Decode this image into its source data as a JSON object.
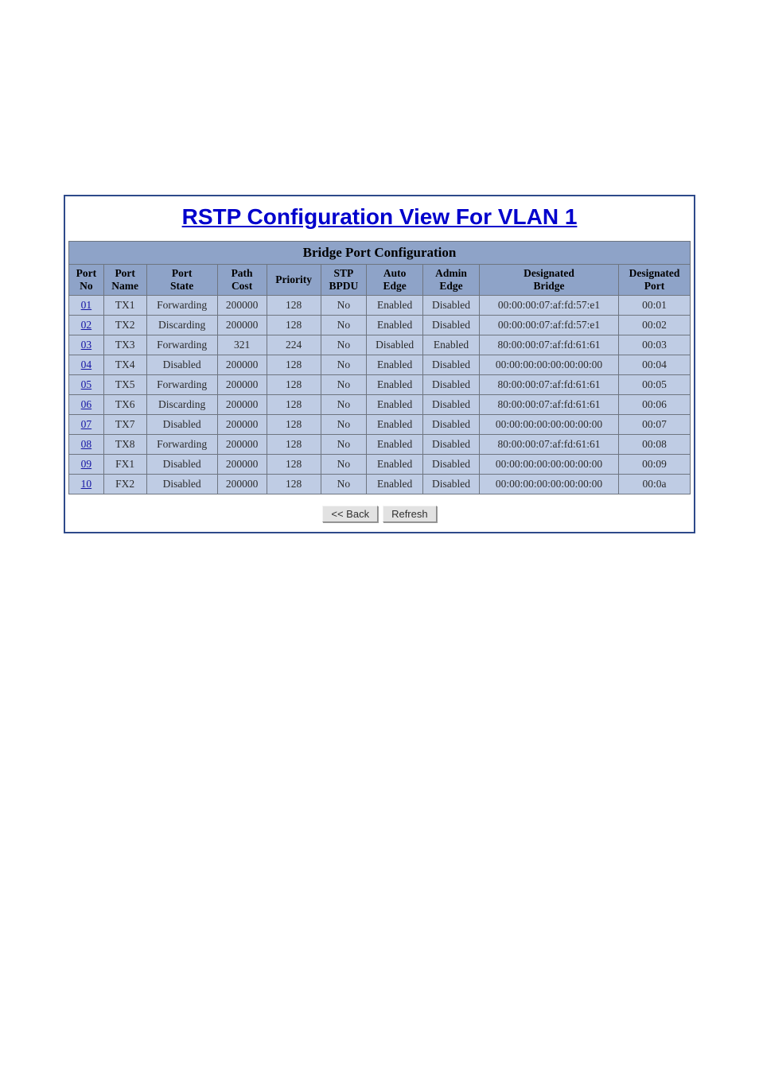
{
  "title": "RSTP Configuration View For VLAN 1",
  "table_caption": "Bridge Port Configuration",
  "headers": {
    "port_no": "Port\nNo",
    "port_name": "Port\nName",
    "port_state": "Port\nState",
    "path_cost": "Path\nCost",
    "priority": "Priority",
    "stp_bpdu": "STP\nBPDU",
    "auto_edge": "Auto\nEdge",
    "admin_edge": "Admin\nEdge",
    "designated_bridge": "Designated\nBridge",
    "designated_port": "Designated\nPort"
  },
  "rows": [
    {
      "port_no": "01",
      "port_name": "TX1",
      "port_state": "Forwarding",
      "path_cost": "200000",
      "priority": "128",
      "stp_bpdu": "No",
      "auto_edge": "Enabled",
      "admin_edge": "Disabled",
      "designated_bridge": "00:00:00:07:af:fd:57:e1",
      "designated_port": "00:01"
    },
    {
      "port_no": "02",
      "port_name": "TX2",
      "port_state": "Discarding",
      "path_cost": "200000",
      "priority": "128",
      "stp_bpdu": "No",
      "auto_edge": "Enabled",
      "admin_edge": "Disabled",
      "designated_bridge": "00:00:00:07:af:fd:57:e1",
      "designated_port": "00:02"
    },
    {
      "port_no": "03",
      "port_name": "TX3",
      "port_state": "Forwarding",
      "path_cost": "321",
      "priority": "224",
      "stp_bpdu": "No",
      "auto_edge": "Disabled",
      "admin_edge": "Enabled",
      "designated_bridge": "80:00:00:07:af:fd:61:61",
      "designated_port": "00:03"
    },
    {
      "port_no": "04",
      "port_name": "TX4",
      "port_state": "Disabled",
      "path_cost": "200000",
      "priority": "128",
      "stp_bpdu": "No",
      "auto_edge": "Enabled",
      "admin_edge": "Disabled",
      "designated_bridge": "00:00:00:00:00:00:00:00",
      "designated_port": "00:04"
    },
    {
      "port_no": "05",
      "port_name": "TX5",
      "port_state": "Forwarding",
      "path_cost": "200000",
      "priority": "128",
      "stp_bpdu": "No",
      "auto_edge": "Enabled",
      "admin_edge": "Disabled",
      "designated_bridge": "80:00:00:07:af:fd:61:61",
      "designated_port": "00:05"
    },
    {
      "port_no": "06",
      "port_name": "TX6",
      "port_state": "Discarding",
      "path_cost": "200000",
      "priority": "128",
      "stp_bpdu": "No",
      "auto_edge": "Enabled",
      "admin_edge": "Disabled",
      "designated_bridge": "80:00:00:07:af:fd:61:61",
      "designated_port": "00:06"
    },
    {
      "port_no": "07",
      "port_name": "TX7",
      "port_state": "Disabled",
      "path_cost": "200000",
      "priority": "128",
      "stp_bpdu": "No",
      "auto_edge": "Enabled",
      "admin_edge": "Disabled",
      "designated_bridge": "00:00:00:00:00:00:00:00",
      "designated_port": "00:07"
    },
    {
      "port_no": "08",
      "port_name": "TX8",
      "port_state": "Forwarding",
      "path_cost": "200000",
      "priority": "128",
      "stp_bpdu": "No",
      "auto_edge": "Enabled",
      "admin_edge": "Disabled",
      "designated_bridge": "80:00:00:07:af:fd:61:61",
      "designated_port": "00:08"
    },
    {
      "port_no": "09",
      "port_name": "FX1",
      "port_state": "Disabled",
      "path_cost": "200000",
      "priority": "128",
      "stp_bpdu": "No",
      "auto_edge": "Enabled",
      "admin_edge": "Disabled",
      "designated_bridge": "00:00:00:00:00:00:00:00",
      "designated_port": "00:09"
    },
    {
      "port_no": "10",
      "port_name": "FX2",
      "port_state": "Disabled",
      "path_cost": "200000",
      "priority": "128",
      "stp_bpdu": "No",
      "auto_edge": "Enabled",
      "admin_edge": "Disabled",
      "designated_bridge": "00:00:00:00:00:00:00:00",
      "designated_port": "00:0a"
    }
  ],
  "buttons": {
    "back": "<< Back",
    "refresh": "Refresh"
  }
}
